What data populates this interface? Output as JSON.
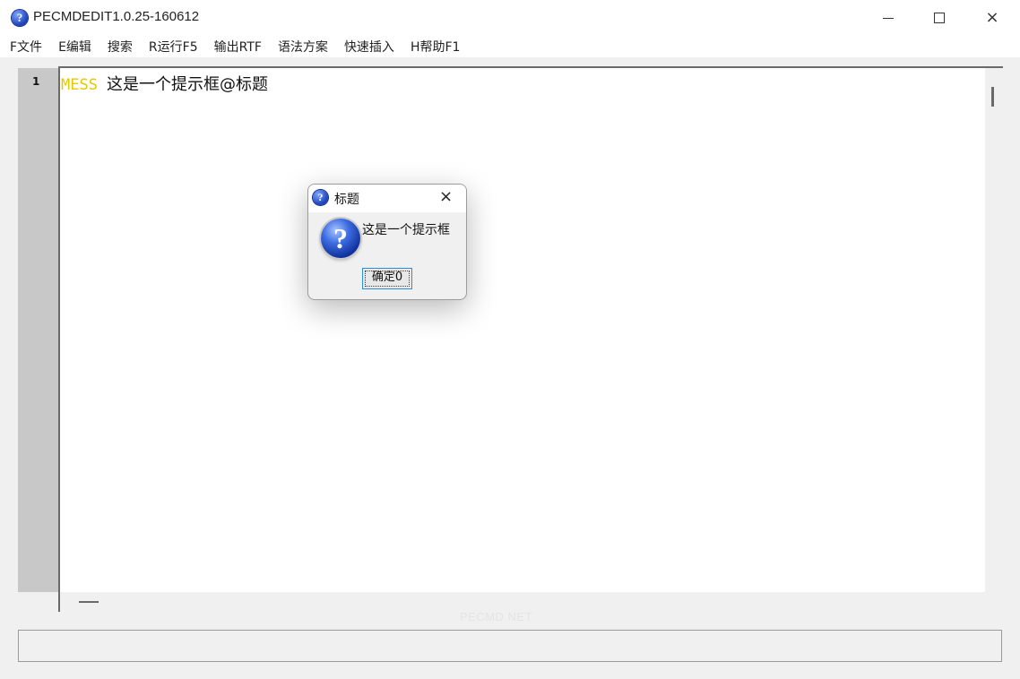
{
  "window": {
    "title": "PECMDEDIT1.0.25-160612",
    "icon": "question-icon",
    "controls": {
      "minimize": "minimize-icon",
      "maximize": "maximize-icon",
      "close": "×"
    }
  },
  "menu": {
    "items": [
      "F文件",
      "E编辑",
      "搜索",
      "R运行F5",
      "输出RTF",
      "语法方案",
      "快速插入",
      "H帮助F1"
    ]
  },
  "editor": {
    "line_number": "1",
    "keyword": "MESS",
    "text": "这是一个提示框@标题",
    "keyword_color": "#e6c800"
  },
  "watermark": "PECMD.NET",
  "dialog": {
    "title": "标题",
    "message": "这是一个提示框",
    "ok_button": "确定0",
    "close": "×",
    "icon": "question-icon",
    "icon_glyph": "?"
  }
}
